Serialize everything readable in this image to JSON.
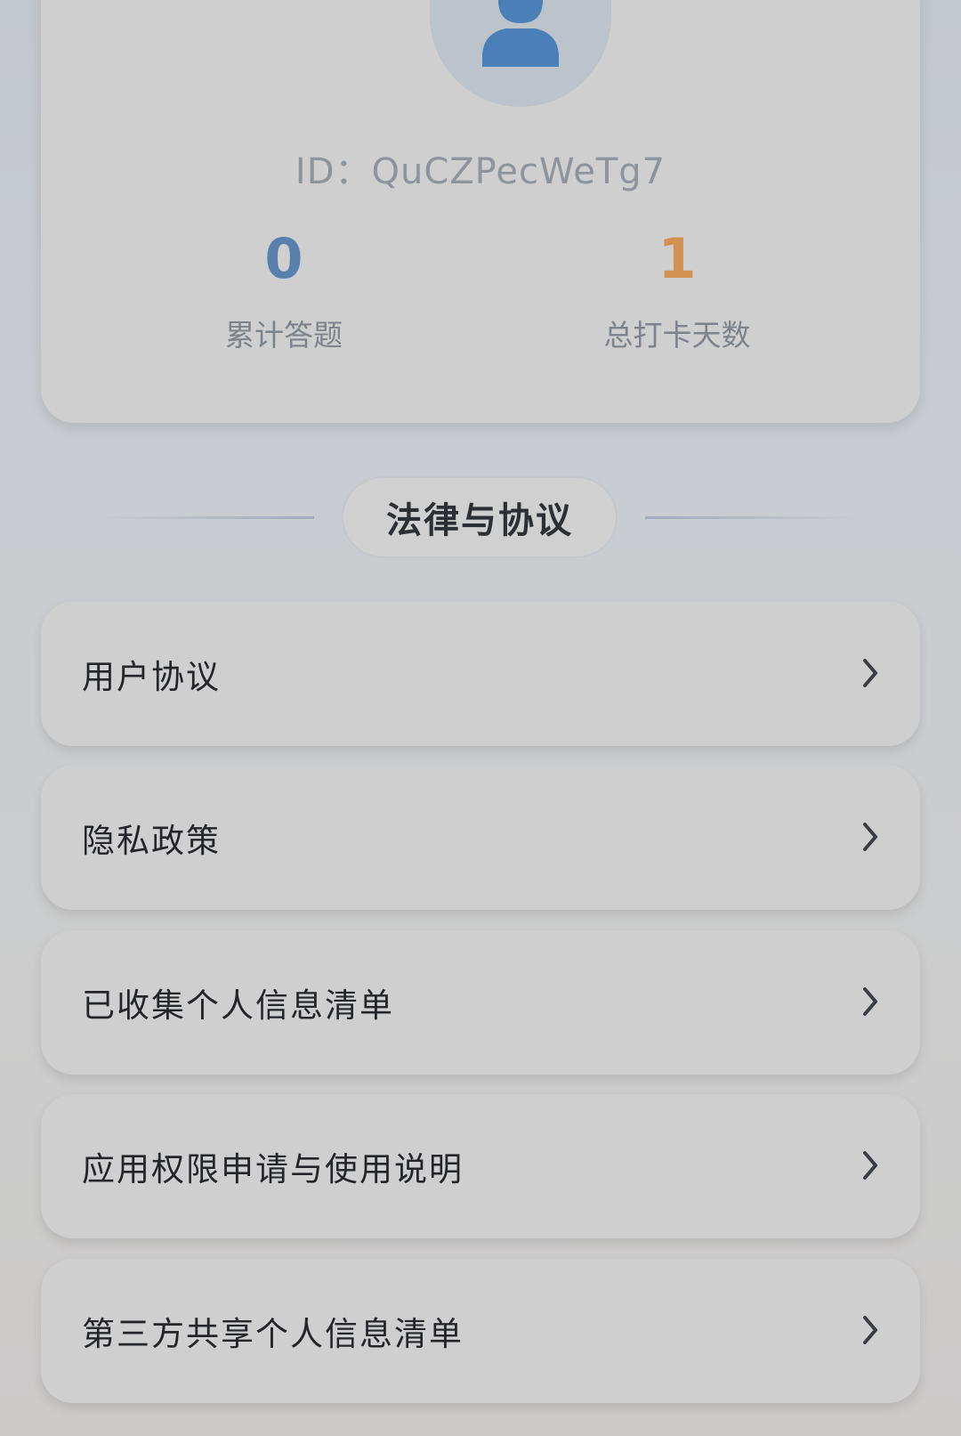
{
  "profile": {
    "id_text": "ID：QuCZPecWeTg7",
    "stats": [
      {
        "value": "0",
        "label": "累计答题"
      },
      {
        "value": "1",
        "label": "总打卡天数"
      }
    ]
  },
  "section": {
    "title": "法律与协议"
  },
  "menu": [
    {
      "label": "用户协议"
    },
    {
      "label": "隐私政策"
    },
    {
      "label": "已收集个人信息清单"
    },
    {
      "label": "应用权限申请与使用说明"
    },
    {
      "label": "第三方共享个人信息清单"
    }
  ],
  "colors": {
    "stat_primary": "#5780ad",
    "stat_accent": "#d2924f",
    "avatar_icon": "#4a7fb8"
  },
  "icons": {
    "avatar": "user-silhouette-icon",
    "menu_arrow": "chevron-right-icon"
  }
}
